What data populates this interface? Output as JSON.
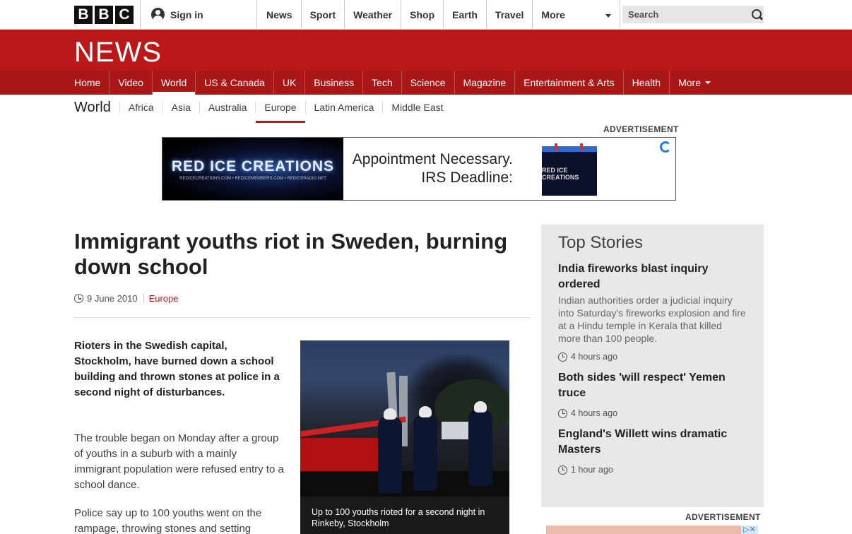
{
  "topbar": {
    "logo_letters": [
      "B",
      "B",
      "C"
    ],
    "signin_label": "Sign in",
    "nav": [
      "News",
      "Sport",
      "Weather",
      "Shop",
      "Earth",
      "Travel"
    ],
    "more_label": "More",
    "search_placeholder": "Search"
  },
  "newsband": {
    "title": "NEWS",
    "nav": [
      {
        "label": "Home",
        "active": false
      },
      {
        "label": "Video",
        "active": false
      },
      {
        "label": "World",
        "active": true
      },
      {
        "label": "US & Canada",
        "active": false
      },
      {
        "label": "UK",
        "active": false
      },
      {
        "label": "Business",
        "active": false
      },
      {
        "label": "Tech",
        "active": false
      },
      {
        "label": "Science",
        "active": false
      },
      {
        "label": "Magazine",
        "active": false
      },
      {
        "label": "Entertainment & Arts",
        "active": false
      },
      {
        "label": "Health",
        "active": false
      }
    ],
    "more_label": "More"
  },
  "subnav": {
    "title": "World",
    "items": [
      {
        "label": "Africa",
        "active": false
      },
      {
        "label": "Asia",
        "active": false
      },
      {
        "label": "Australia",
        "active": false
      },
      {
        "label": "Europe",
        "active": true
      },
      {
        "label": "Latin America",
        "active": false
      },
      {
        "label": "Middle East",
        "active": false
      }
    ]
  },
  "ad_top": {
    "label": "ADVERTISEMENT",
    "brand": "RED ICE CREATIONS",
    "brand_small": "REDICECREATIONS.COM • REDICEMEMBERS.COM • REDICERADIO.NET",
    "line1": "Appointment Necessary.",
    "line2": "IRS Deadline:",
    "cal_text": "RED ICE CREATIONS"
  },
  "article": {
    "headline": "Immigrant youths riot in Sweden, burning down school",
    "date": "9 June 2010",
    "category": "Europe",
    "lead": "Rioters in the Swedish capital, Stockholm, have burned down a school building and thrown stones at police in a second night of disturbances.",
    "paragraphs": [
      "The trouble began on Monday after a group of youths in a suburb with a mainly immigrant population were refused entry to a school dance.",
      "Police say up to 100 youths went on the rampage, throwing stones and setting"
    ],
    "caption": "Up to 100 youths rioted for a second night in Rinkeby, Stockholm"
  },
  "sidebar": {
    "heading": "Top Stories",
    "stories": [
      {
        "title": "India fireworks blast inquiry ordered",
        "summary": "Indian authorities order a judicial inquiry into Saturday's fireworks explosion and fire at a Hindu temple in Kerala that killed more than 100 people.",
        "time": "4 hours ago"
      },
      {
        "title": "Both sides 'will respect' Yemen truce",
        "summary": "",
        "time": "4 hours ago"
      },
      {
        "title": "England's Willett wins dramatic Masters",
        "summary": "",
        "time": "1 hour ago"
      }
    ],
    "ad_label": "ADVERTISEMENT"
  },
  "colors": {
    "brand_red": "#bb1919",
    "nav_red": "#a91717",
    "sidebar_bg": "#e8e8e8"
  }
}
